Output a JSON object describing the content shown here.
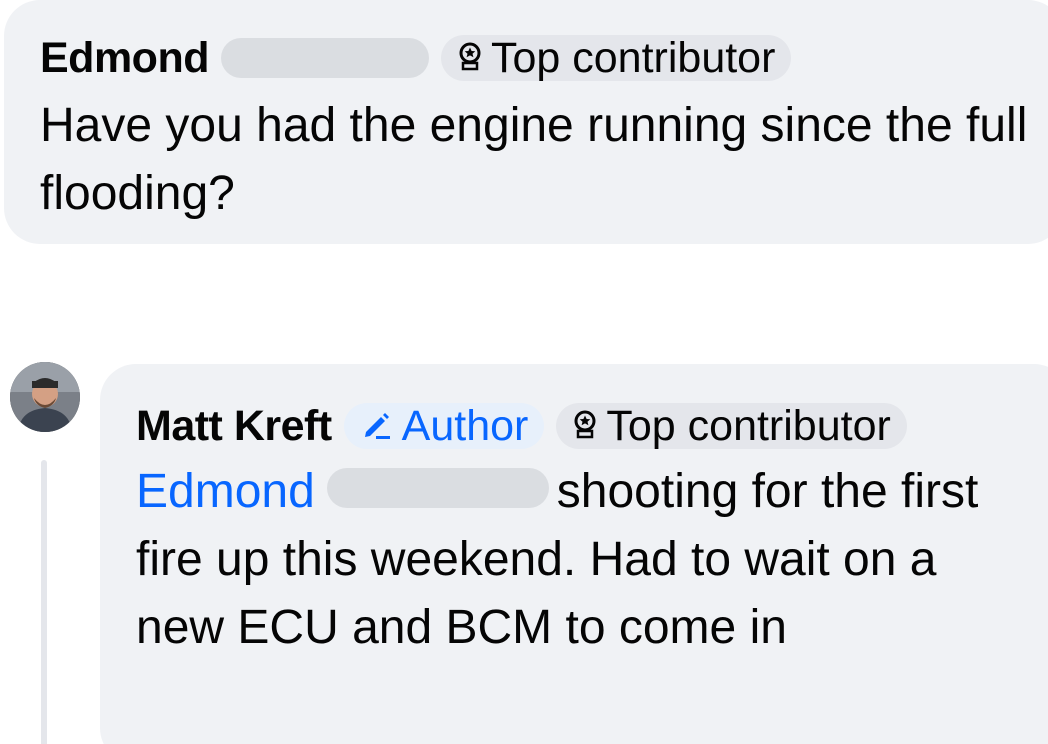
{
  "comments": [
    {
      "author": "Edmond",
      "badges": [
        {
          "label": "Top contributor",
          "icon": "top-contributor-icon"
        }
      ],
      "text": "Have you had the engine running since the full flooding?"
    },
    {
      "author": "Matt Kreft",
      "badges": [
        {
          "label": "Author",
          "icon": "pencil-icon"
        },
        {
          "label": "Top contributor",
          "icon": "top-contributor-icon"
        }
      ],
      "mention": "Edmond",
      "text": "shooting for the first fire up this weekend. Had to wait on a new ECU and BCM to come in"
    }
  ],
  "colors": {
    "bubble_bg": "#f0f2f5",
    "badge_bg": "#e4e6eb",
    "author_badge_bg": "#e7f0fb",
    "link_blue": "#0866ff",
    "redaction": "#dadde1"
  }
}
